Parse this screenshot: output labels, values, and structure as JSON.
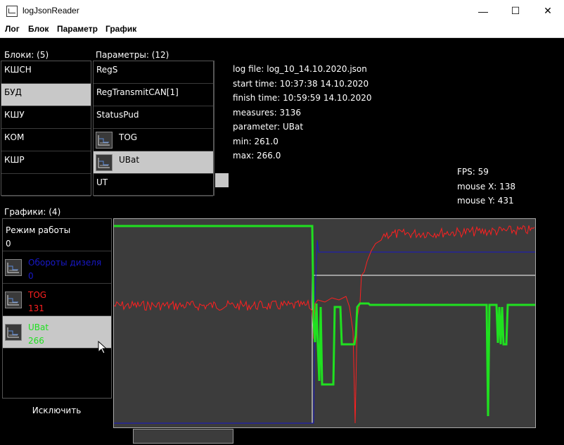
{
  "window": {
    "title": "logJsonReader",
    "minimize": "—",
    "maximize": "☐",
    "close": "✕"
  },
  "menu": [
    "Лог",
    "Блок",
    "Параметр",
    "График"
  ],
  "blocks": {
    "label": "Блоки: (5)",
    "items": [
      "КШСН",
      "БУД",
      "КШУ",
      "КОМ",
      "КШР"
    ],
    "selected_index": 1
  },
  "params": {
    "label": "Параметры: (12)",
    "items": [
      "RegS",
      "RegTransmitCAN[1]",
      "StatusPud",
      "TOG",
      "UBat",
      "UT"
    ],
    "selected_index": 4
  },
  "info": {
    "log_file": "log file: log_10_14.10.2020.json",
    "start_time": "start time: 10:37:38 14.10.2020",
    "finish_time": "finish time: 10:59:59 14.10.2020",
    "measures": "measures: 3136",
    "parameter": "parameter: UBat",
    "min": "min: 261.0",
    "max": "max: 266.0"
  },
  "stats": {
    "fps": "FPS: 59",
    "mouse_x": "mouse X: 138",
    "mouse_y": "mouse Y: 431"
  },
  "graphs": {
    "label": "Графики: (4)",
    "items": [
      {
        "name": "Режим работы",
        "value": "0",
        "color": "#ffffff",
        "icon": false
      },
      {
        "name": "Обороты дизеля",
        "value": "0",
        "color": "#1818c8",
        "icon": true
      },
      {
        "name": "TOG",
        "value": "131",
        "color": "#ff2020",
        "icon": true
      },
      {
        "name": "UBat",
        "value": "266",
        "color": "#20e020",
        "icon": true
      }
    ],
    "selected_index": 3,
    "exclude_button": "Исключить"
  },
  "chart_data": {
    "type": "line",
    "series": [
      {
        "name": "Режим работы",
        "color": "#ffffff",
        "values": [
          0,
          0,
          0,
          0,
          0,
          0,
          0,
          0,
          0.7,
          0.7,
          0.7,
          0.7,
          0.7,
          0.7,
          0.7,
          0.7,
          0.7,
          0.7,
          0.7,
          0.7
        ]
      },
      {
        "name": "Обороты дизеля",
        "color": "#1818c8",
        "values": [
          0,
          0,
          0,
          0,
          0,
          0,
          0,
          0,
          0.82,
          0.82,
          0.82,
          0.82,
          0.82,
          0.82,
          0.82,
          0.82,
          0.82,
          0.82,
          0.82,
          0.82
        ]
      },
      {
        "name": "TOG",
        "color": "#ff2020",
        "values": [
          0.58,
          0.58,
          0.58,
          0.58,
          0.58,
          0.58,
          0.58,
          0.58,
          0.57,
          0.55,
          0.68,
          0.86,
          0.89,
          0.91,
          0.92,
          0.93,
          0.93,
          0.94,
          0.94,
          0.95
        ]
      },
      {
        "name": "UBat",
        "color": "#20e020",
        "values": [
          0.96,
          0.96,
          0.96,
          0.96,
          0.96,
          0.96,
          0.96,
          0.96,
          0.55,
          0.2,
          0.55,
          0.4,
          0.55,
          0.55,
          0.55,
          0.55,
          0.55,
          0.55,
          0.55,
          0.55
        ]
      }
    ]
  }
}
